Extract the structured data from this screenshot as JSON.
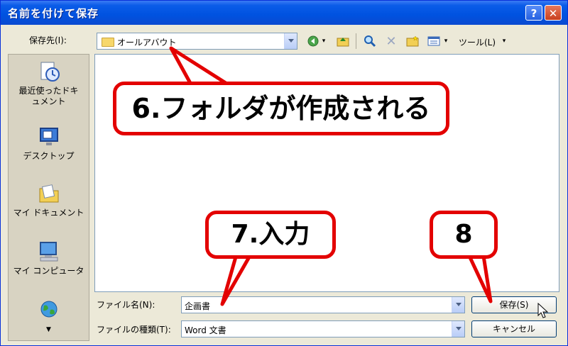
{
  "dialog": {
    "title": "名前を付けて保存"
  },
  "save_in": {
    "label": "保存先(I):",
    "value": "オールアバウト"
  },
  "toolbar": {
    "tools_label": "ツール(L)"
  },
  "places": [
    {
      "label": "最近使ったドキュメント",
      "icon": "recent-documents-icon"
    },
    {
      "label": "デスクトップ",
      "icon": "desktop-icon"
    },
    {
      "label": "マイ ドキュメント",
      "icon": "my-documents-icon"
    },
    {
      "label": "マイ コンピュータ",
      "icon": "my-computer-icon"
    },
    {
      "label": "",
      "icon": "network-icon"
    }
  ],
  "filename": {
    "label": "ファイル名(N):",
    "value": "企画書"
  },
  "filetype": {
    "label": "ファイルの種類(T):",
    "value": "Word 文書"
  },
  "buttons": {
    "save": "保存(S)",
    "cancel": "キャンセル"
  },
  "annotations": {
    "folder_created": "6.フォルダが作成される",
    "enter_name": "7.入力",
    "step8": "8"
  },
  "colors": {
    "accent": "#e30000",
    "titlebar": "#0a5ce8"
  }
}
